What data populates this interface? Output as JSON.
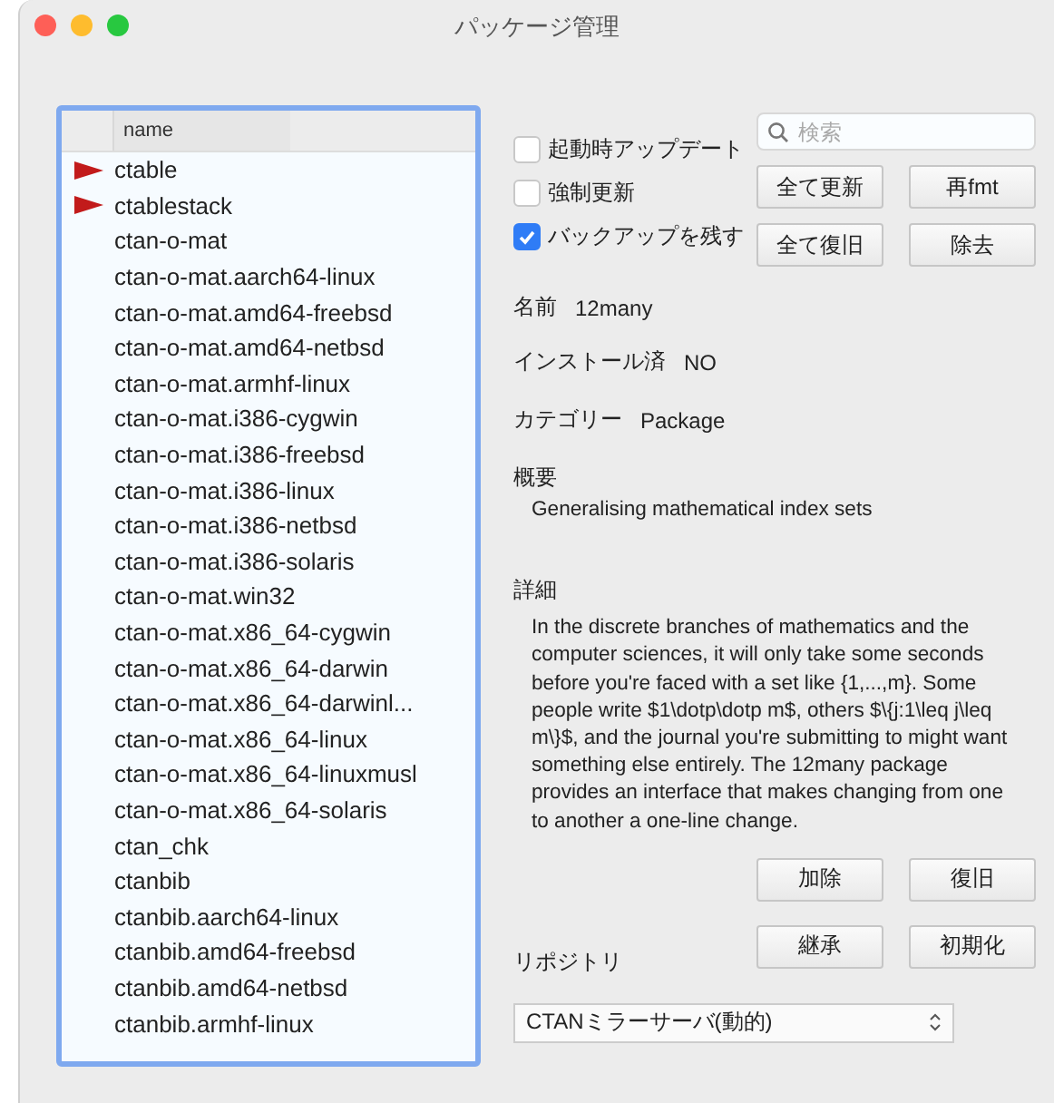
{
  "window": {
    "title": "パッケージ管理"
  },
  "package_list": {
    "column": "name",
    "rows": [
      {
        "name": "ctable",
        "flagged": true
      },
      {
        "name": "ctablestack",
        "flagged": true
      },
      {
        "name": "ctan-o-mat",
        "flagged": false
      },
      {
        "name": "ctan-o-mat.aarch64-linux",
        "flagged": false
      },
      {
        "name": "ctan-o-mat.amd64-freebsd",
        "flagged": false
      },
      {
        "name": "ctan-o-mat.amd64-netbsd",
        "flagged": false
      },
      {
        "name": "ctan-o-mat.armhf-linux",
        "flagged": false
      },
      {
        "name": "ctan-o-mat.i386-cygwin",
        "flagged": false
      },
      {
        "name": "ctan-o-mat.i386-freebsd",
        "flagged": false
      },
      {
        "name": "ctan-o-mat.i386-linux",
        "flagged": false
      },
      {
        "name": "ctan-o-mat.i386-netbsd",
        "flagged": false
      },
      {
        "name": "ctan-o-mat.i386-solaris",
        "flagged": false
      },
      {
        "name": "ctan-o-mat.win32",
        "flagged": false
      },
      {
        "name": "ctan-o-mat.x86_64-cygwin",
        "flagged": false
      },
      {
        "name": "ctan-o-mat.x86_64-darwin",
        "flagged": false
      },
      {
        "name": "ctan-o-mat.x86_64-darwinl...",
        "flagged": false
      },
      {
        "name": "ctan-o-mat.x86_64-linux",
        "flagged": false
      },
      {
        "name": "ctan-o-mat.x86_64-linuxmusl",
        "flagged": false
      },
      {
        "name": "ctan-o-mat.x86_64-solaris",
        "flagged": false
      },
      {
        "name": "ctan_chk",
        "flagged": false
      },
      {
        "name": "ctanbib",
        "flagged": false
      },
      {
        "name": "ctanbib.aarch64-linux",
        "flagged": false
      },
      {
        "name": "ctanbib.amd64-freebsd",
        "flagged": false
      },
      {
        "name": "ctanbib.amd64-netbsd",
        "flagged": false
      },
      {
        "name": "ctanbib.armhf-linux",
        "flagged": false
      }
    ]
  },
  "options": [
    {
      "label": "起動時アップデート",
      "checked": false
    },
    {
      "label": "強制更新",
      "checked": false
    },
    {
      "label": "バックアップを残す",
      "checked": true
    }
  ],
  "search": {
    "placeholder": "検索"
  },
  "top_buttons": [
    "全て更新",
    "再fmt",
    "全て復旧",
    "除去"
  ],
  "info": {
    "name_label": "名前",
    "name": "12many",
    "installed_label": "インストール済",
    "installed": "NO",
    "category_label": "カテゴリー",
    "category": "Package",
    "summary_label": "概要",
    "summary": "Generalising mathematical index sets",
    "details_label": "詳細",
    "details": "In the discrete branches of mathematics and the computer sciences, it will only take some seconds before you're faced with a set like {1,...,m}. Some people write $1\\dotp\\dotp m$, others $\\{j:1\\leq j\\leq m\\}$, and the journal you're submitting to might want something else entirely. The 12many package provides an interface that makes changing from one to another a one-line change."
  },
  "bottom_buttons": [
    "加除",
    "復旧",
    "継承",
    "初期化"
  ],
  "repository": {
    "label": "リポジトリ",
    "value": "CTANミラーサーバ(動的)"
  }
}
